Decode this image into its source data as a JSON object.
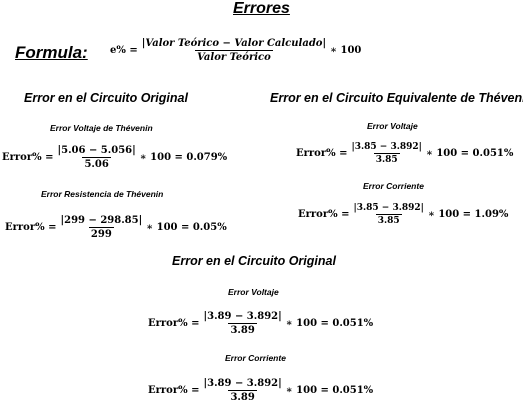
{
  "title": "Errores",
  "formula": {
    "label": "Formula:",
    "lhs": "e% =",
    "numerator": "|Valor Teórico − Valor Calculado|",
    "denominator": "Valor Teórico",
    "rhs": "∗ 100"
  },
  "section_original": {
    "heading": "Error en el Circuito Original",
    "voltage": {
      "label": "Error Voltaje de Thévenin",
      "lhs": "Error% =",
      "numerator": "|5.06 − 5.056|",
      "denominator": "5.06",
      "rhs": "∗ 100 = 0.079%"
    },
    "resistance": {
      "label": "Error Resistencia de Thévenin",
      "lhs": "Error% =",
      "numerator": "|299 − 298.85|",
      "denominator": "299",
      "rhs": "∗ 100 = 0.05%"
    }
  },
  "section_equivalent": {
    "heading": "Error en el Circuito Equivalente de Thévenin",
    "voltage": {
      "label": "Error Voltaje",
      "lhs": "Error% =",
      "numerator": "|3.85 − 3.892|",
      "denominator": "3.85",
      "rhs": "∗ 100 = 0.051%"
    },
    "current": {
      "label": "Error Corriente",
      "lhs": "Error% =",
      "numerator": "|3.85 − 3.892|",
      "denominator": "3.85",
      "rhs": "∗ 100 = 1.09%"
    }
  },
  "section_original_2": {
    "heading": "Error en el Circuito Original",
    "voltage": {
      "label": "Error Voltaje",
      "lhs": "Error% =",
      "numerator": "|3.89 − 3.892|",
      "denominator": "3.89",
      "rhs": "∗ 100 = 0.051%"
    },
    "current": {
      "label": "Error Corriente",
      "lhs": "Error% =",
      "numerator": "|3.89 − 3.892|",
      "denominator": "3.89",
      "rhs": "∗ 100 = 0.051%"
    }
  }
}
